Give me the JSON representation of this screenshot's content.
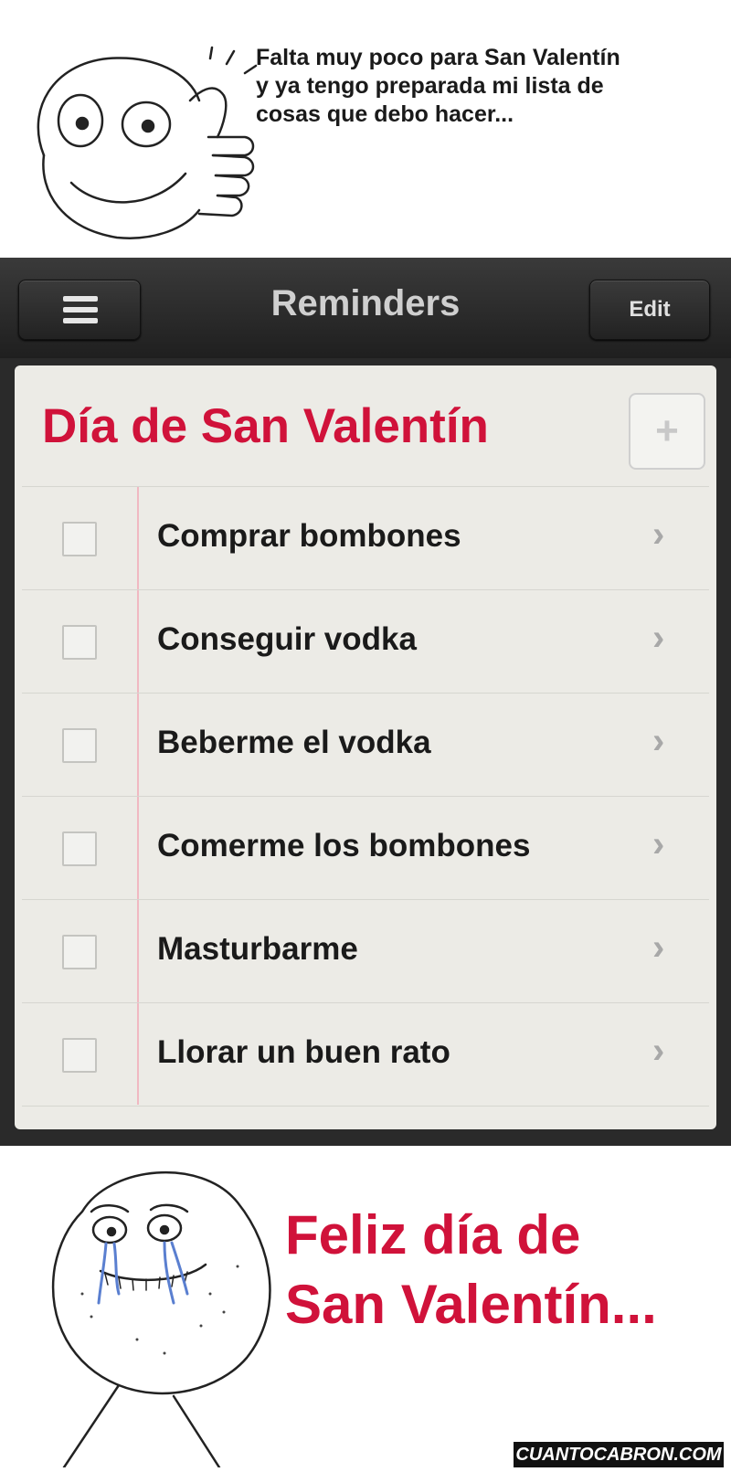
{
  "top_panel": {
    "caption": "Falta muy poco para San Valentín\ny ya tengo preparada mi lista de\ncosas que debo hacer..."
  },
  "app": {
    "nav_title": "Reminders",
    "edit_label": "Edit",
    "list_title": "Día de San Valentín",
    "add_symbol": "+",
    "items": [
      {
        "text": "Comprar bombones",
        "checked": false
      },
      {
        "text": "Conseguir vodka",
        "checked": false
      },
      {
        "text": "Beberme el vodka",
        "checked": false
      },
      {
        "text": "Comerme los bombones",
        "checked": false
      },
      {
        "text": "Masturbarme",
        "checked": false
      },
      {
        "text": "Llorar un buen rato",
        "checked": false
      }
    ],
    "chevron": "›",
    "accent_color": "#d0123a"
  },
  "bottom_panel": {
    "caption": "Feliz día de\nSan Valentín...",
    "watermark": "CUANTOCABRON.COM"
  }
}
